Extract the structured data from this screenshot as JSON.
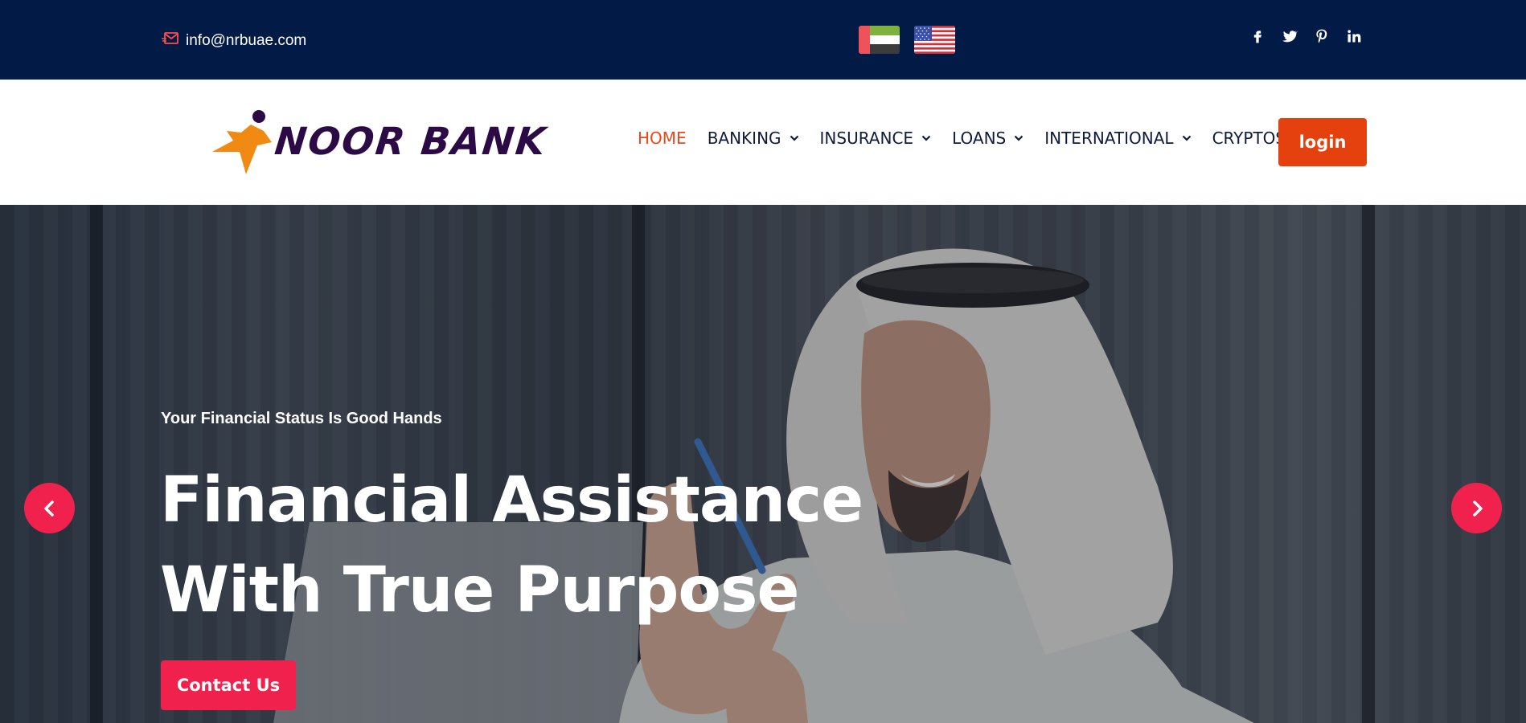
{
  "topbar": {
    "email": "info@nrbuae.com",
    "flags": [
      "uae-flag",
      "us-flag"
    ],
    "social": [
      "facebook-icon",
      "twitter-icon",
      "pinterest-icon",
      "linkedin-icon"
    ]
  },
  "brand": {
    "name": "NOOR BANK"
  },
  "nav": {
    "items": [
      {
        "label": "HOME",
        "active": true,
        "dropdown": false
      },
      {
        "label": "BANKING",
        "active": false,
        "dropdown": true
      },
      {
        "label": "INSURANCE",
        "active": false,
        "dropdown": true
      },
      {
        "label": "LOANS",
        "active": false,
        "dropdown": true
      },
      {
        "label": "INTERNATIONAL",
        "active": false,
        "dropdown": true
      },
      {
        "label": "CRYPTOS",
        "active": false,
        "dropdown": false
      }
    ],
    "login_label": "login"
  },
  "hero": {
    "subtitle": "Your Financial Status Is Good Hands",
    "title_line1": "Financial Assistance",
    "title_line2": "With True Purpose",
    "cta_label": "Contact Us"
  },
  "colors": {
    "topbar_bg": "#021b46",
    "accent_orange": "#e4410f",
    "accent_pink": "#f0224d",
    "brand_purple": "#2b0a45"
  }
}
